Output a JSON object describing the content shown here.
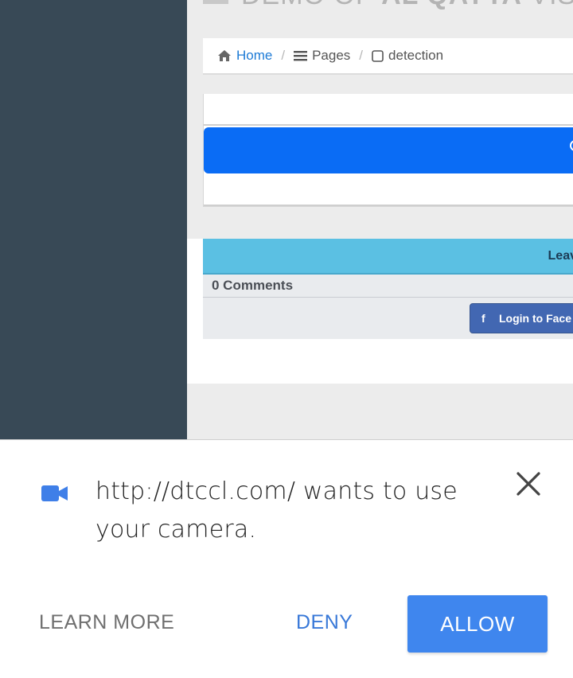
{
  "page": {
    "heading_prefix": "DEMO OF",
    "heading_bold": "AL QAYYA",
    "heading_suffix": "VISION"
  },
  "breadcrumb": {
    "home": "Home",
    "pages": "Pages",
    "current": "detection",
    "separator": "/"
  },
  "comments": {
    "leave_label": "Leav",
    "count_label": "0 Comments",
    "fb_button": "Login to Face"
  },
  "dialog": {
    "message": "http://dtccl.com/ wants to use your camera.",
    "learn_more": "LEARN MORE",
    "deny": "DENY",
    "allow": "ALLOW"
  },
  "colors": {
    "sidebar": "#384956",
    "link": "#1e7bd6",
    "primary_bar": "#0a6cf5",
    "leave_bar": "#5bc0e3",
    "facebook": "#4267b2",
    "allow": "#3f86ee",
    "deny_text": "#3878d8"
  },
  "icons": [
    "home-icon",
    "list-icon",
    "checkbox-icon",
    "lightbulb-icon",
    "facebook-icon",
    "camera-icon",
    "close-icon"
  ]
}
